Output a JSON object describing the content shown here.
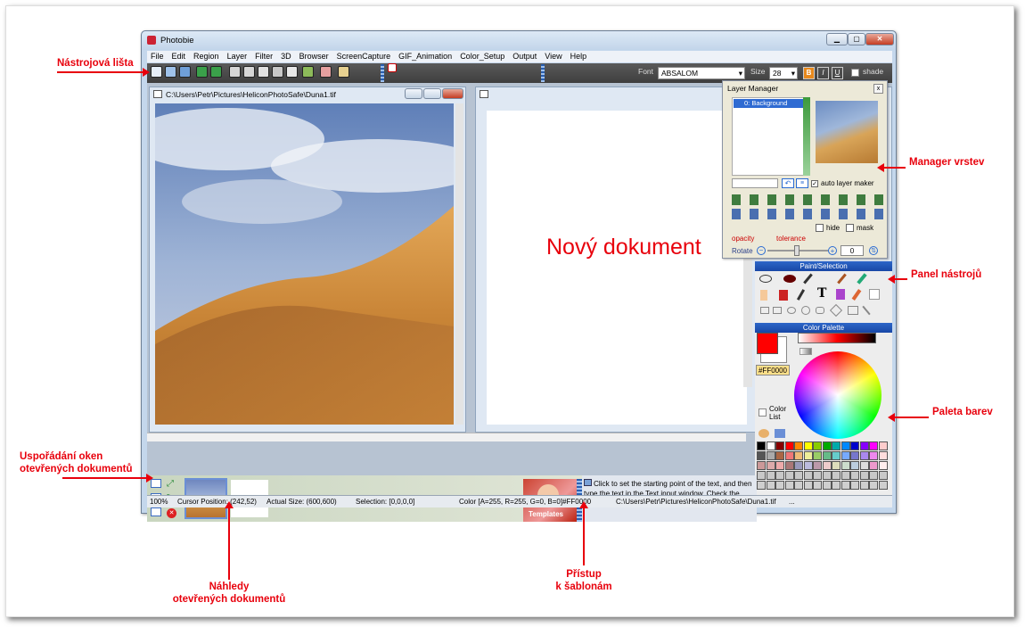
{
  "annotations": {
    "toolbar": "Nástrojová lišta",
    "arrange_line1": "Uspořádání oken",
    "arrange_line2": "otevřených dokumentů",
    "thumbs_line1": "Náhledy",
    "thumbs_line2": "otevřených dokumentů",
    "templates_line1": "Přístup",
    "templates_line2": "k šablonám",
    "layer_manager": "Manager vrstev",
    "tools_panel": "Panel nástrojů",
    "palette": "Paleta barev",
    "new_doc": "Nový dokument",
    "color": "#e8000c"
  },
  "window": {
    "title": "Photobie",
    "min": "▁",
    "max": "▢",
    "close": "✕"
  },
  "menu": [
    "File",
    "Edit",
    "Region",
    "Layer",
    "Filter",
    "3D",
    "Browser",
    "ScreenCapture",
    "GIF_Animation",
    "Color_Setup",
    "Output",
    "View",
    "Help"
  ],
  "toolbar": {
    "font_label": "Font",
    "font_value": "ABSALOM",
    "size_label": "Size",
    "size_value": "28",
    "bold": "B",
    "italic": "I",
    "underline": "U",
    "shade": "shade"
  },
  "doc1": {
    "path": "C:\\Users\\Petr\\Pictures\\HeliconPhotoSafe\\Duna1.tif"
  },
  "layer_manager": {
    "title": "Layer Manager",
    "layer_name": "0: Background",
    "auto": "auto layer maker",
    "hide": "hide",
    "mask": "mask",
    "opacity": "opacity",
    "tolerance": "tolerance",
    "rotate": "Rotate",
    "rotate_value": "0"
  },
  "paint_panel": {
    "title": "Paint/Selection",
    "text_tool": "T"
  },
  "color_palette": {
    "title": "Color Palette",
    "hex": "#FF0000",
    "color_list": "Color List",
    "fg": "#ff0000",
    "bg": "#ffffff"
  },
  "bottom": {
    "templates": "Templates",
    "hint": "Click to set the starting point of the text, and then type the text in the Text input window. Check the preview to see the result."
  },
  "status": {
    "zoom": "100%",
    "cursor": "Cursor Position: (242,52)",
    "actual": "Actual Size: (600,600)",
    "selection": "Selection: [0,0,0,0]",
    "color": "Color [A=255, R=255, G=0, B=0]#FF0000",
    "path": "C:\\Users\\Petr\\Pictures\\HeliconPhotoSafe\\Duna1.tif",
    "more": "..."
  }
}
